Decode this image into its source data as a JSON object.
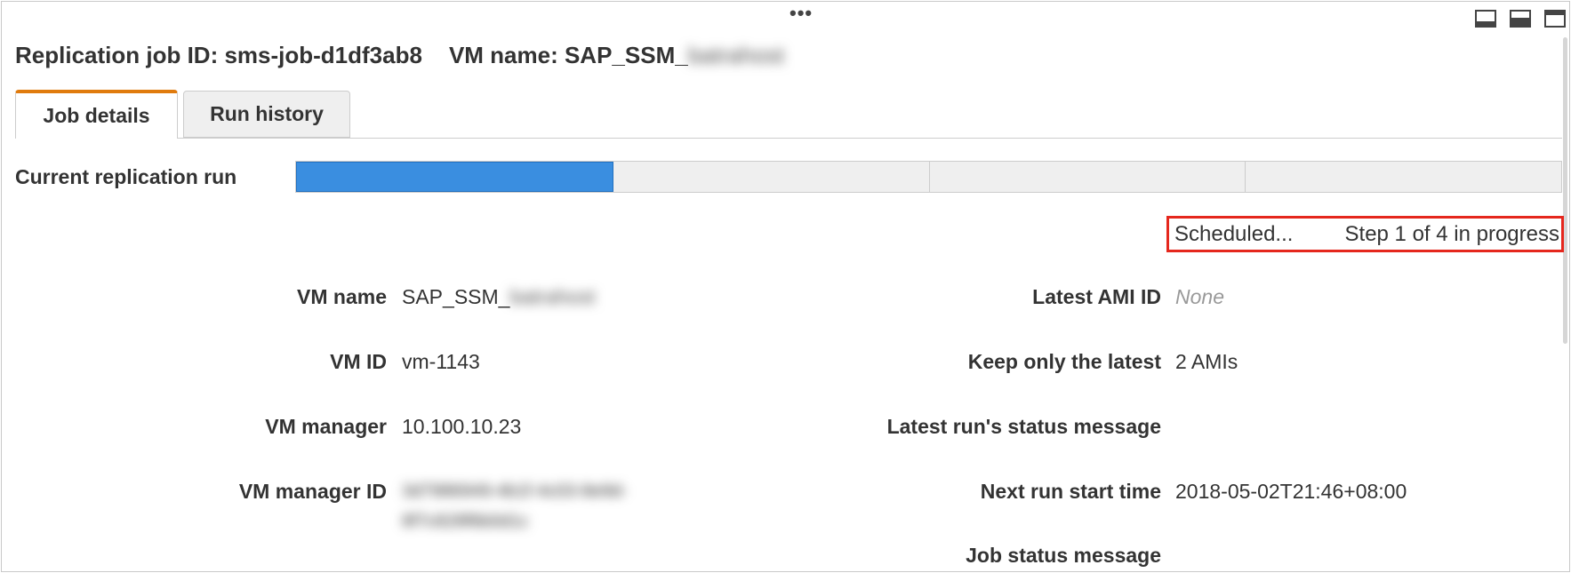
{
  "window": {
    "drag_handle": "•••",
    "layout_buttons": [
      "minimize-panel-icon",
      "split-panel-icon",
      "maximize-panel-icon"
    ]
  },
  "header": {
    "job_id_text": "Replication job ID: sms-job-d1df3ab8",
    "vm_name_prefix": "VM name: SAP_SSM_",
    "vm_name_redacted": "batrahost"
  },
  "tabs": [
    {
      "label": "Job details",
      "active": true
    },
    {
      "label": "Run history",
      "active": false
    }
  ],
  "replication": {
    "label": "Current replication run",
    "total_steps": 4,
    "completed_steps": 1,
    "status_text": "Scheduled...",
    "step_text": "Step 1 of 4 in progress",
    "accent_color": "#3a8ee0",
    "highlight_color": "#e5271d"
  },
  "details_left": [
    {
      "label": "VM name",
      "value": "SAP_SSM_",
      "redacted": "batrahost"
    },
    {
      "label": "VM ID",
      "value": "vm-1143"
    },
    {
      "label": "VM manager",
      "value": "10.100.10.23"
    },
    {
      "label": "VM manager ID",
      "value": "",
      "redacted_line1": "3d7986949-4b1f-4c03-8e9d-",
      "redacted_line2": "8f7c828f6b0d1c"
    }
  ],
  "details_right": [
    {
      "label": "Latest AMI ID",
      "value": "None"
    },
    {
      "label": "Keep only the latest",
      "value": "2 AMIs"
    },
    {
      "label": "Latest run's status message",
      "value": ""
    },
    {
      "label": "Next run start time",
      "value": "2018-05-02T21:46+08:00"
    },
    {
      "label": "Job status message",
      "value": ""
    }
  ],
  "tab_accent_color": "#e07b0e"
}
